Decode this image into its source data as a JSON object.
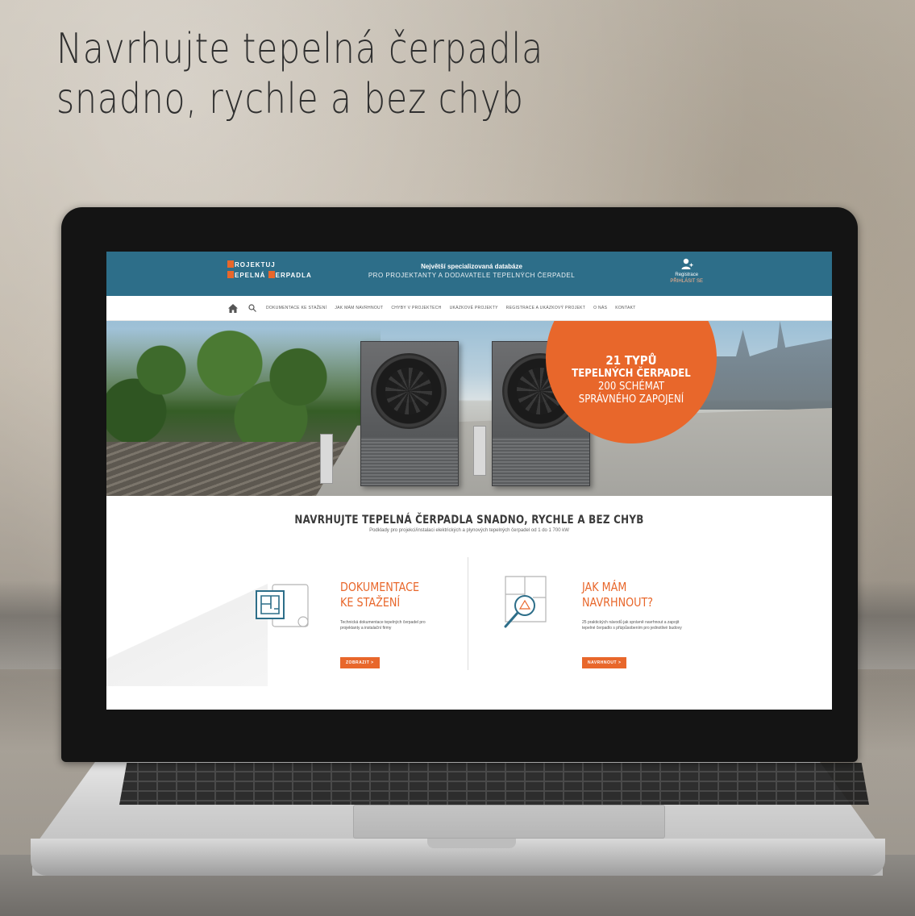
{
  "headline": {
    "line1": "Navrhujte tepelná čerpadla",
    "line2": "snadno, rychle a bez chyb"
  },
  "site": {
    "logo": {
      "line1_initial": "P",
      "line1_rest": "ROJEKTUJ",
      "line2_initial": "T",
      "line2_mid": "EPELNÁ ",
      "line2_initial2": "Č",
      "line2_rest": "ERPADLA"
    },
    "header": {
      "tagline1": "Největší specializovaná databáze",
      "tagline2": "PRO PROJEKTANTY A DODAVATELE TEPELNÝCH ČERPADEL",
      "register_label": "Registrace",
      "register_sub": "PŘIHLÁSIT SE",
      "register_icon": "user-add-icon"
    },
    "nav": {
      "home_icon": "home-icon",
      "search_icon": "search-icon",
      "items": [
        "DOKUMENTACE KE STAŽENÍ",
        "JAK MÁM NAVRHNOUT",
        "CHYBY V PROJEKTECH",
        "UKÁZKOVÉ PROJEKTY",
        "REGISTRACE A UKÁZKOVÝ PROJEKT",
        "O NÁS",
        "KONTAKT"
      ]
    },
    "hero_badge": {
      "line1": "21 TYPŮ",
      "line2": "TEPELNÝCH ČERPADEL",
      "line3": "200 SCHÉMAT",
      "line4": "SPRÁVNÉHO ZAPOJENÍ"
    },
    "main": {
      "title": "NAVRHUJTE TEPELNÁ ČERPADLA SNADNO, RYCHLE A BEZ CHYB",
      "subtitle": "Podklady pro projekci/instalaci elektrických a plynových tepelných čerpadel od 1 do 1 700 kW"
    },
    "cards": [
      {
        "title1": "DOKUMENTACE",
        "title2": "KE STAŽENÍ",
        "desc": "Technická dokumentace tepelných čerpadel pro projektanty a instalační firmy",
        "button": "ZOBRAZIT >",
        "icon": "blueprint-icon"
      },
      {
        "title1": "JAK MÁM",
        "title2": "NAVRHNOUT?",
        "desc": "25 praktických návodů jak správně navrhnout a zapojit tepelné čerpadlo s přizpůsobením pro jednotlivé budovy",
        "button": "NAVRHNOUT >",
        "icon": "magnifier-plan-icon"
      }
    ]
  },
  "colors": {
    "header_blue": "#2d6e89",
    "accent_orange": "#e8672b"
  }
}
